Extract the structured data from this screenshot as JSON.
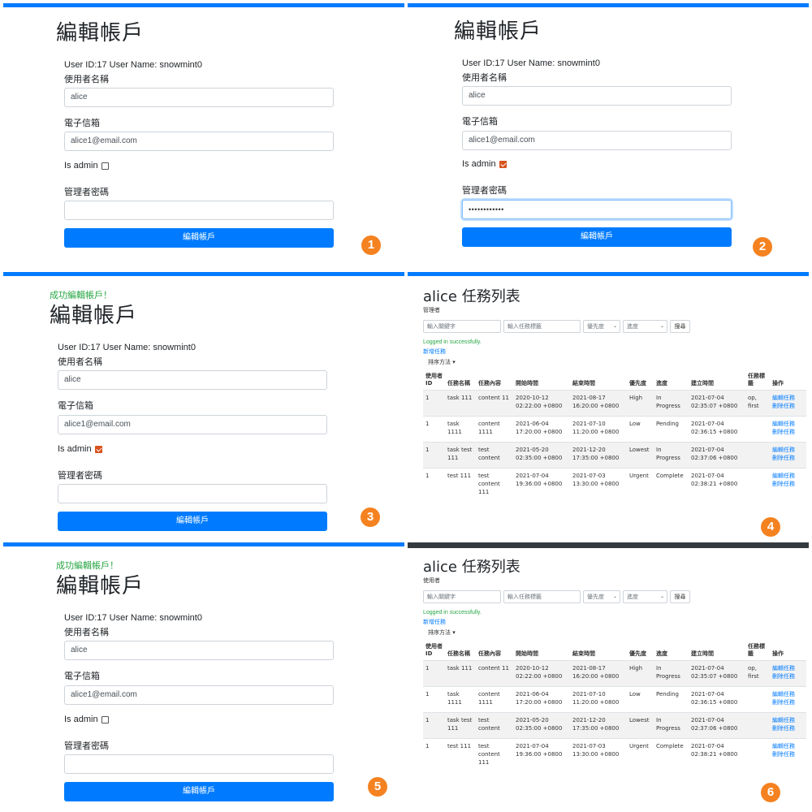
{
  "form": {
    "title": "編輯帳戶",
    "userinfo": "User ID:17 User Name: snowmint0",
    "username_label": "使用者名稱",
    "username_value": "alice",
    "email_label": "電子信箱",
    "email_value": "alice1@email.com",
    "admin_label": "Is admin",
    "admin_pwd_label": "管理者密碼",
    "admin_pwd_masked": "••••••••••••",
    "submit_label": "編輯帳戶",
    "success_msg": "成功編輯帳戶！"
  },
  "panels": {
    "p1": {
      "step": "1",
      "is_admin": false
    },
    "p2": {
      "step": "2",
      "is_admin": true
    },
    "p3": {
      "step": "3",
      "is_admin": true
    },
    "p5": {
      "step": "5",
      "is_admin": false
    }
  },
  "tasklist": {
    "title": "alice 任務列表",
    "role": "管理者",
    "role_p6": "使用者",
    "keyword_placeholder": "輸入關鍵字",
    "tag_placeholder": "輸入任務標籤",
    "priority_label": "優先度",
    "status_label": "進度",
    "search_label": "搜尋",
    "logged_msg": "Logged in successfully.",
    "add_task": "新增任務",
    "sort_label": "排序方法",
    "steps": {
      "p4": "4",
      "p6": "6"
    },
    "columns": [
      "使用者ID",
      "任務名稱",
      "任務內容",
      "開始時間",
      "結束時間",
      "優先度",
      "進度",
      "建立時間",
      "任務標籤",
      "操作"
    ],
    "edit_link": "編輯任務",
    "delete_link": "刪除任務",
    "rows": [
      {
        "uid": "1",
        "name": "task 111",
        "content": "content 11",
        "start": "2020-10-12 02:22:00 +0800",
        "end": "2021-08-17 16:20:00 +0800",
        "priority": "High",
        "status": "In Progress",
        "created": "2021-07-04 02:35:07 +0800",
        "tags": "op, first"
      },
      {
        "uid": "1",
        "name": "task 1111",
        "content": "content 1111",
        "start": "2021-06-04 17:20:00 +0800",
        "end": "2021-07-10 11:20:00 +0800",
        "priority": "Low",
        "status": "Pending",
        "created": "2021-07-04 02:36:15 +0800",
        "tags": ""
      },
      {
        "uid": "1",
        "name": "task test 111",
        "content": "test content",
        "start": "2021-05-20 02:35:00 +0800",
        "end": "2021-12-20 17:35:00 +0800",
        "priority": "Lowest",
        "status": "In Progress",
        "created": "2021-07-04 02:37:06 +0800",
        "tags": ""
      },
      {
        "uid": "1",
        "name": "test 111",
        "content": "test content 111",
        "start": "2021-07-04 19:36:00 +0800",
        "end": "2021-07-03 13:30:00 +0800",
        "priority": "Urgent",
        "status": "Complete",
        "created": "2021-07-04 02:38:21 +0800",
        "tags": ""
      }
    ]
  },
  "colors": {
    "primary": "#007bff",
    "success": "#28a745",
    "badge": "#f58220",
    "checkbox_checked": "#d9531e",
    "dark_bar": "#343a40"
  }
}
